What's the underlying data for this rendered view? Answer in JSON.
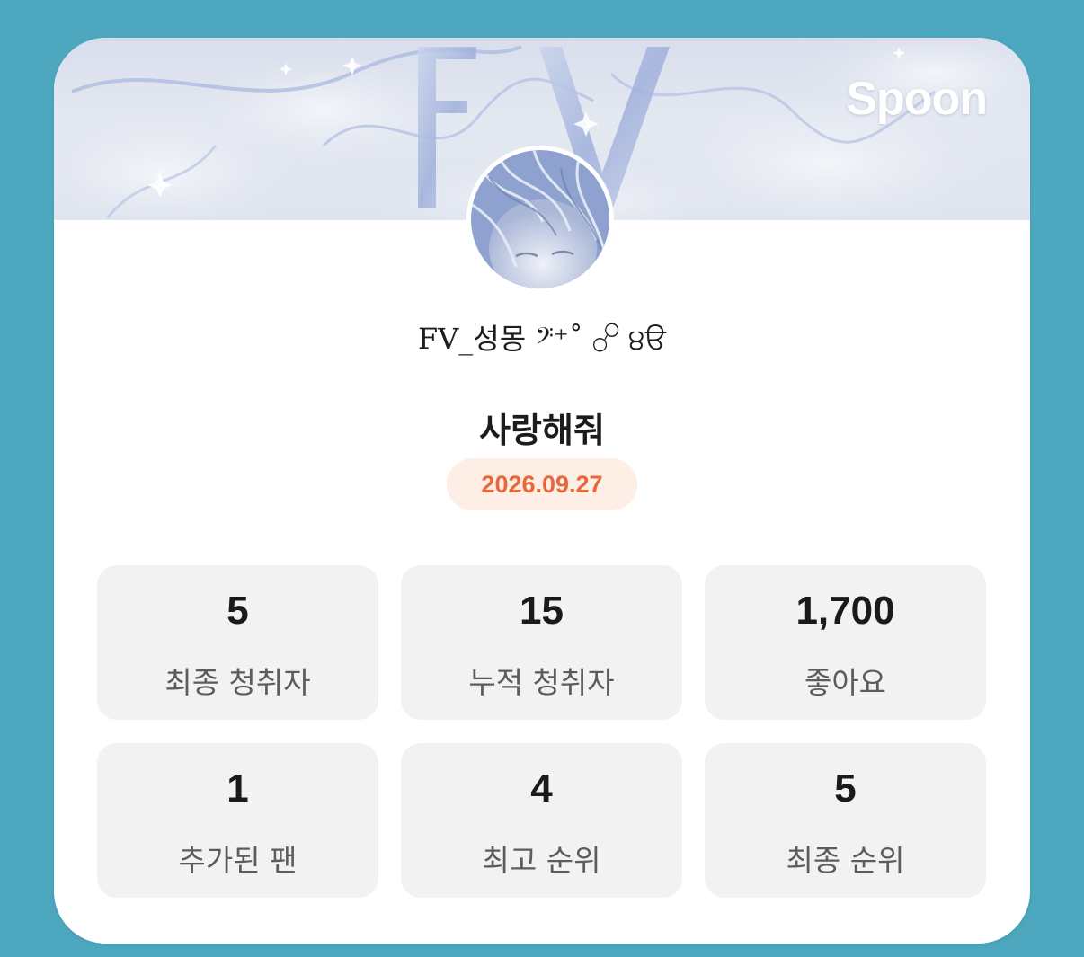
{
  "brand": "Spoon",
  "profile": {
    "nickname": "FV_성몽 𝄢⁺˚ ☍ ੪ੳ"
  },
  "live": {
    "title": "사랑해줘",
    "date": "2026.09.27"
  },
  "stats": [
    {
      "value": "5",
      "label": "최종 청취자"
    },
    {
      "value": "15",
      "label": "누적 청취자"
    },
    {
      "value": "1,700",
      "label": "좋아요"
    },
    {
      "value": "1",
      "label": "추가된 팬"
    },
    {
      "value": "4",
      "label": "최고 순위"
    },
    {
      "value": "5",
      "label": "최종 순위"
    }
  ],
  "colors": {
    "background": "#4da8bf",
    "card": "#ffffff",
    "date_text": "#e8683a",
    "date_pill": "#fdeee6",
    "stat_box": "#f2f2f2"
  }
}
